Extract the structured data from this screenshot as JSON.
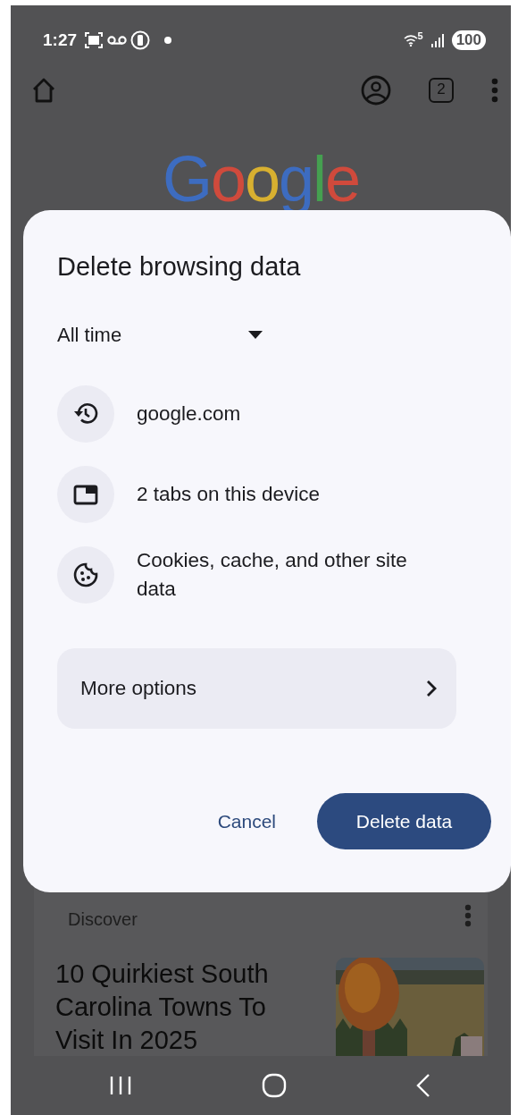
{
  "status_bar": {
    "time": "1:27",
    "wifi_band": "5",
    "battery": "100"
  },
  "toolbar": {
    "tab_count": "2"
  },
  "logo": "Google",
  "feed": {
    "heading": "Discover",
    "article_title": "10 Quirkiest South Carolina Towns To Visit In 2025"
  },
  "dialog": {
    "title": "Delete browsing data",
    "time_range": "All time",
    "items": [
      {
        "kind": "history",
        "label": "google.com"
      },
      {
        "kind": "tabs",
        "label": "2 tabs on this device"
      },
      {
        "kind": "cookies",
        "label": "Cookies, cache, and other site data"
      }
    ],
    "more_options": "More options",
    "buttons": [
      {
        "kind": "text",
        "label": "Cancel"
      },
      {
        "kind": "filled",
        "label": "Delete data"
      }
    ]
  }
}
